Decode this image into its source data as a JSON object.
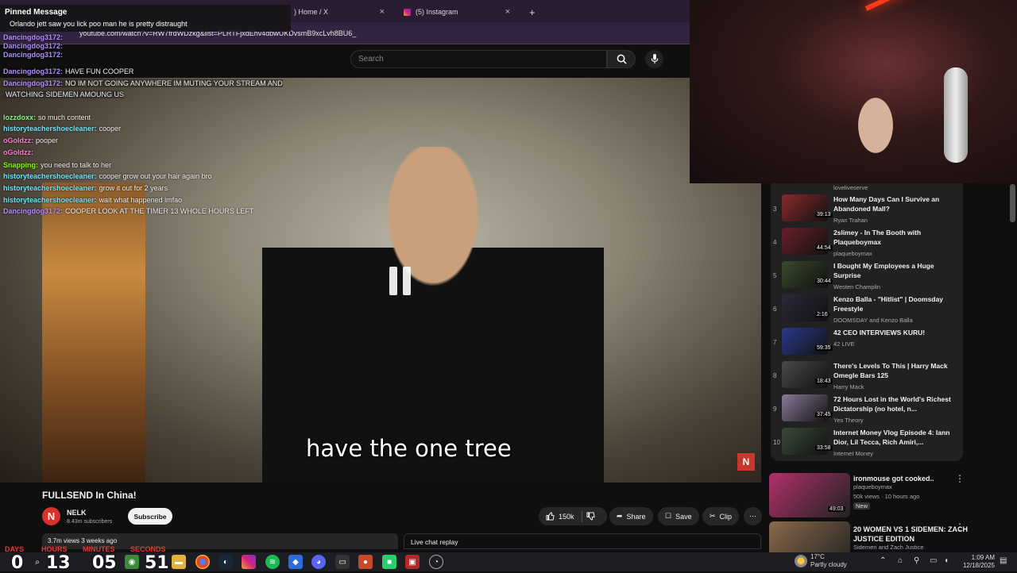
{
  "browser": {
    "tabs": [
      {
        "label": ") Home / X"
      },
      {
        "label": "(5) Instagram"
      }
    ],
    "new_tab": "+",
    "url": "youtube.com/watch?v=RW7frdWDzkg&list=PLRTFjxdEhv4dbwUKDvsmB9xcLvh8BU6_"
  },
  "youtube": {
    "search_placeholder": "Search",
    "video": {
      "subtitle": "have the one tree",
      "channel_logo": "N",
      "title": "FULLSEND In China!",
      "channel": "NELK",
      "subscribers": "8.43m subscribers",
      "subscribe": "Subscribe",
      "likes": "150k",
      "share": "Share",
      "save": "Save",
      "clip": "Clip",
      "views_date": "3.7m views  3 weeks ago",
      "live_chat": "Live chat replay"
    },
    "playlist": {
      "top_channel": "loveliveserve",
      "items": [
        {
          "num": "3",
          "title": "How Many Days Can I Survive an Abandoned Mall?",
          "channel": "Ryan Trahan",
          "duration": "39:13",
          "color": "#8a2a2a"
        },
        {
          "num": "4",
          "title": "2slimey - In The Booth with Plaqueboymax",
          "channel": "plaqueboymax",
          "duration": "44:54",
          "color": "#6a1f2a"
        },
        {
          "num": "5",
          "title": "I Bought My Employees a Huge Surprise",
          "channel": "Westen Champlin",
          "duration": "30:44",
          "color": "#3a4a2a"
        },
        {
          "num": "6",
          "title": "Kenzo Balla - \"Hitlist\" | Doomsday Freestyle",
          "channel": "DOOMSDAY and Kenzo Balla",
          "duration": "2:16",
          "color": "#2a2a3a"
        },
        {
          "num": "7",
          "title": "42 CEO INTERVIEWS KURU!",
          "channel": "42 LIVE",
          "duration": "59:35",
          "color": "#2a3a8a"
        },
        {
          "num": "8",
          "title": "There's Levels To This | Harry Mack Omegle Bars 125",
          "channel": "Harry Mack",
          "duration": "18:43",
          "color": "#4a4a4a"
        },
        {
          "num": "9",
          "title": "72 Hours Lost in the World's Richest Dictatorship (no hotel, n...",
          "channel": "Yes Theory",
          "duration": "37:45",
          "color": "#8a7a9a"
        },
        {
          "num": "10",
          "title": "Internet Money Vlog Episode 4: Iann Dior, Lil Tecca, Rich Amiri,...",
          "channel": "Internet Money",
          "duration": "33:58",
          "color": "#3a4a3a"
        }
      ]
    },
    "recommended": [
      {
        "title": "ironmouse got cooked..",
        "channel": "plaqueboymax",
        "stats": "50k views · 10 hours ago",
        "badge": "New",
        "duration": "49:03",
        "color": "#b0306a"
      },
      {
        "title": "20 WOMEN VS 1 SIDEMEN: ZACH JUSTICE EDITION",
        "channel": "Sidemen and Zach Justice",
        "duration": "",
        "color": "#8a6a4a"
      }
    ]
  },
  "chat": {
    "pinned_label": "Pinned Message",
    "pinned_text": "Orlando jett saw you lick poo man he is pretty distraught",
    "lines": [
      {
        "user": "Dancingdog3172:",
        "text": "",
        "color": "#b48cff"
      },
      {
        "user": "Dancingdog3172:",
        "text": "",
        "color": "#b48cff"
      },
      {
        "user": "Dancingdog3172:",
        "text": "",
        "color": "#b48cff"
      },
      {
        "user": "Dancingdog3172:",
        "text": "HAVE FUN COOPER",
        "color": "#b48cff"
      },
      {
        "user": "Dancingdog3172:",
        "text": "NO IM NOT GOING ANYWHERE IM MUTING YOUR STREAM AND",
        "color": "#b48cff"
      },
      {
        "user": "",
        "text": "WATCHING SIDEMEN AMOUNG US",
        "color": "#b48cff"
      },
      {
        "user": "lozzdoxx:",
        "text": "so much content",
        "color": "#7fff7f"
      },
      {
        "user": "historyteachershoecleaner:",
        "text": "cooper",
        "color": "#6fe6ff"
      },
      {
        "user": "oGoldzz:",
        "text": "pooper",
        "color": "#ff7ad9"
      },
      {
        "user": "oGoldzz:",
        "text": "",
        "color": "#ff7ad9"
      },
      {
        "user": "Snapping:",
        "text": "you need to talk to her",
        "color": "#7fff00"
      },
      {
        "user": "historyteachershoecleaner:",
        "text": "cooper grow out your hair again bro",
        "color": "#6fe6ff"
      },
      {
        "user": "historyteachershoecleaner:",
        "text": "grow it out for 2 years",
        "color": "#6fe6ff"
      },
      {
        "user": "historyteachershoecleaner:",
        "text": "wait what happened lmfao",
        "color": "#6fe6ff"
      },
      {
        "user": "Dancingdog3172:",
        "text": "COOPER LOOK AT THE TIMER 13 WHOLE HOURS LEFT",
        "color": "#b48cff"
      }
    ]
  },
  "countdown": {
    "days_label": "DAYS",
    "hours_label": "HOURS",
    "minutes_label": "MINUTES",
    "seconds_label": "SECONDS",
    "days": "0",
    "hours": "13",
    "minutes": "05",
    "seconds": "51"
  },
  "taskbar": {
    "weather_temp": "17°C",
    "weather_desc": "Partly cloudy",
    "time": "1:09 AM",
    "date": "12/18/2025"
  }
}
